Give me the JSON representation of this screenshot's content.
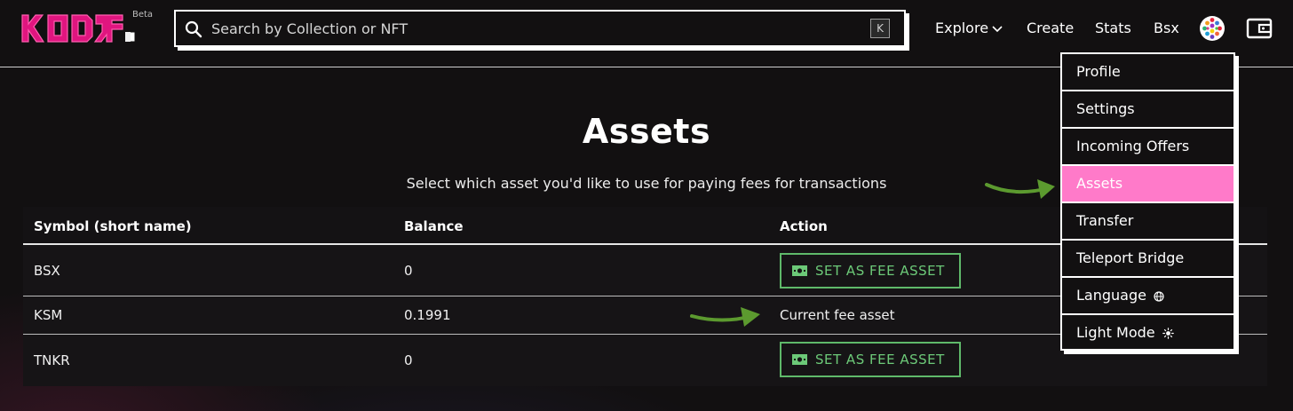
{
  "header": {
    "logo_text": "KODA",
    "beta_label": "Beta",
    "search": {
      "placeholder": "Search by Collection or NFT",
      "shortcut_key": "K"
    },
    "nav": {
      "explore": "Explore",
      "create": "Create",
      "stats": "Stats",
      "chain": "Bsx"
    },
    "icons": [
      "search-icon",
      "chevron-down-icon",
      "avatar",
      "wallet-icon"
    ]
  },
  "main": {
    "title": "Assets",
    "subtitle": "Select which asset you'd like to use for paying fees for transactions",
    "table": {
      "headers": {
        "symbol": "Symbol (short name)",
        "balance": "Balance",
        "action": "Action"
      },
      "rows": [
        {
          "symbol": "BSX",
          "balance": "0",
          "action": "SET AS FEE ASSET"
        },
        {
          "symbol": "KSM",
          "balance": "0.1991",
          "action": "Current fee asset"
        },
        {
          "symbol": "TNKR",
          "balance": "0",
          "action": "SET AS FEE ASSET"
        }
      ]
    }
  },
  "menu": {
    "items": [
      {
        "label": "Profile"
      },
      {
        "label": "Settings"
      },
      {
        "label": "Incoming Offers"
      },
      {
        "label": "Assets",
        "active": true
      },
      {
        "label": "Transfer"
      },
      {
        "label": "Teleport Bridge"
      },
      {
        "label": "Language",
        "icon": "globe-icon"
      },
      {
        "label": "Light Mode",
        "icon": "sun-icon"
      }
    ]
  },
  "colors": {
    "brand_pink": "#ff7ac9",
    "logo_magenta": "#e0157f",
    "fee_button_green": "#5fb96a",
    "annotation_arrow_green": "#5c9a2f",
    "background": "#121011"
  }
}
